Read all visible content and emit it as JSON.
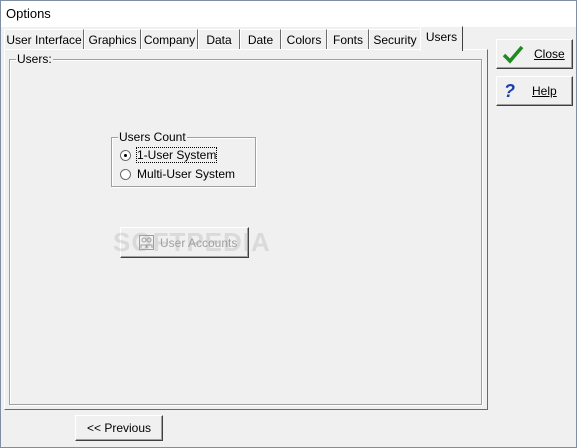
{
  "window": {
    "title": "Options"
  },
  "tabs": [
    {
      "label": "User Interface"
    },
    {
      "label": "Graphics"
    },
    {
      "label": "Company"
    },
    {
      "label": "Data"
    },
    {
      "label": "Date"
    },
    {
      "label": "Colors"
    },
    {
      "label": "Fonts"
    },
    {
      "label": "Security"
    },
    {
      "label": "Users",
      "active": true
    }
  ],
  "panel": {
    "group_label": "Users:",
    "users_count": {
      "label": "Users Count",
      "options": [
        {
          "label": "1-User System",
          "selected": true
        },
        {
          "label": "Multi-User System",
          "selected": false
        }
      ]
    },
    "user_accounts_button": {
      "label": "User Accounts",
      "enabled": false
    }
  },
  "side_buttons": {
    "close": {
      "label": "Close",
      "icon": "checkmark-icon"
    },
    "help": {
      "label": "Help",
      "icon": "question-mark-icon"
    }
  },
  "bottom": {
    "previous_label": "<< Previous"
  },
  "watermark": "SOFTPEDIA"
}
